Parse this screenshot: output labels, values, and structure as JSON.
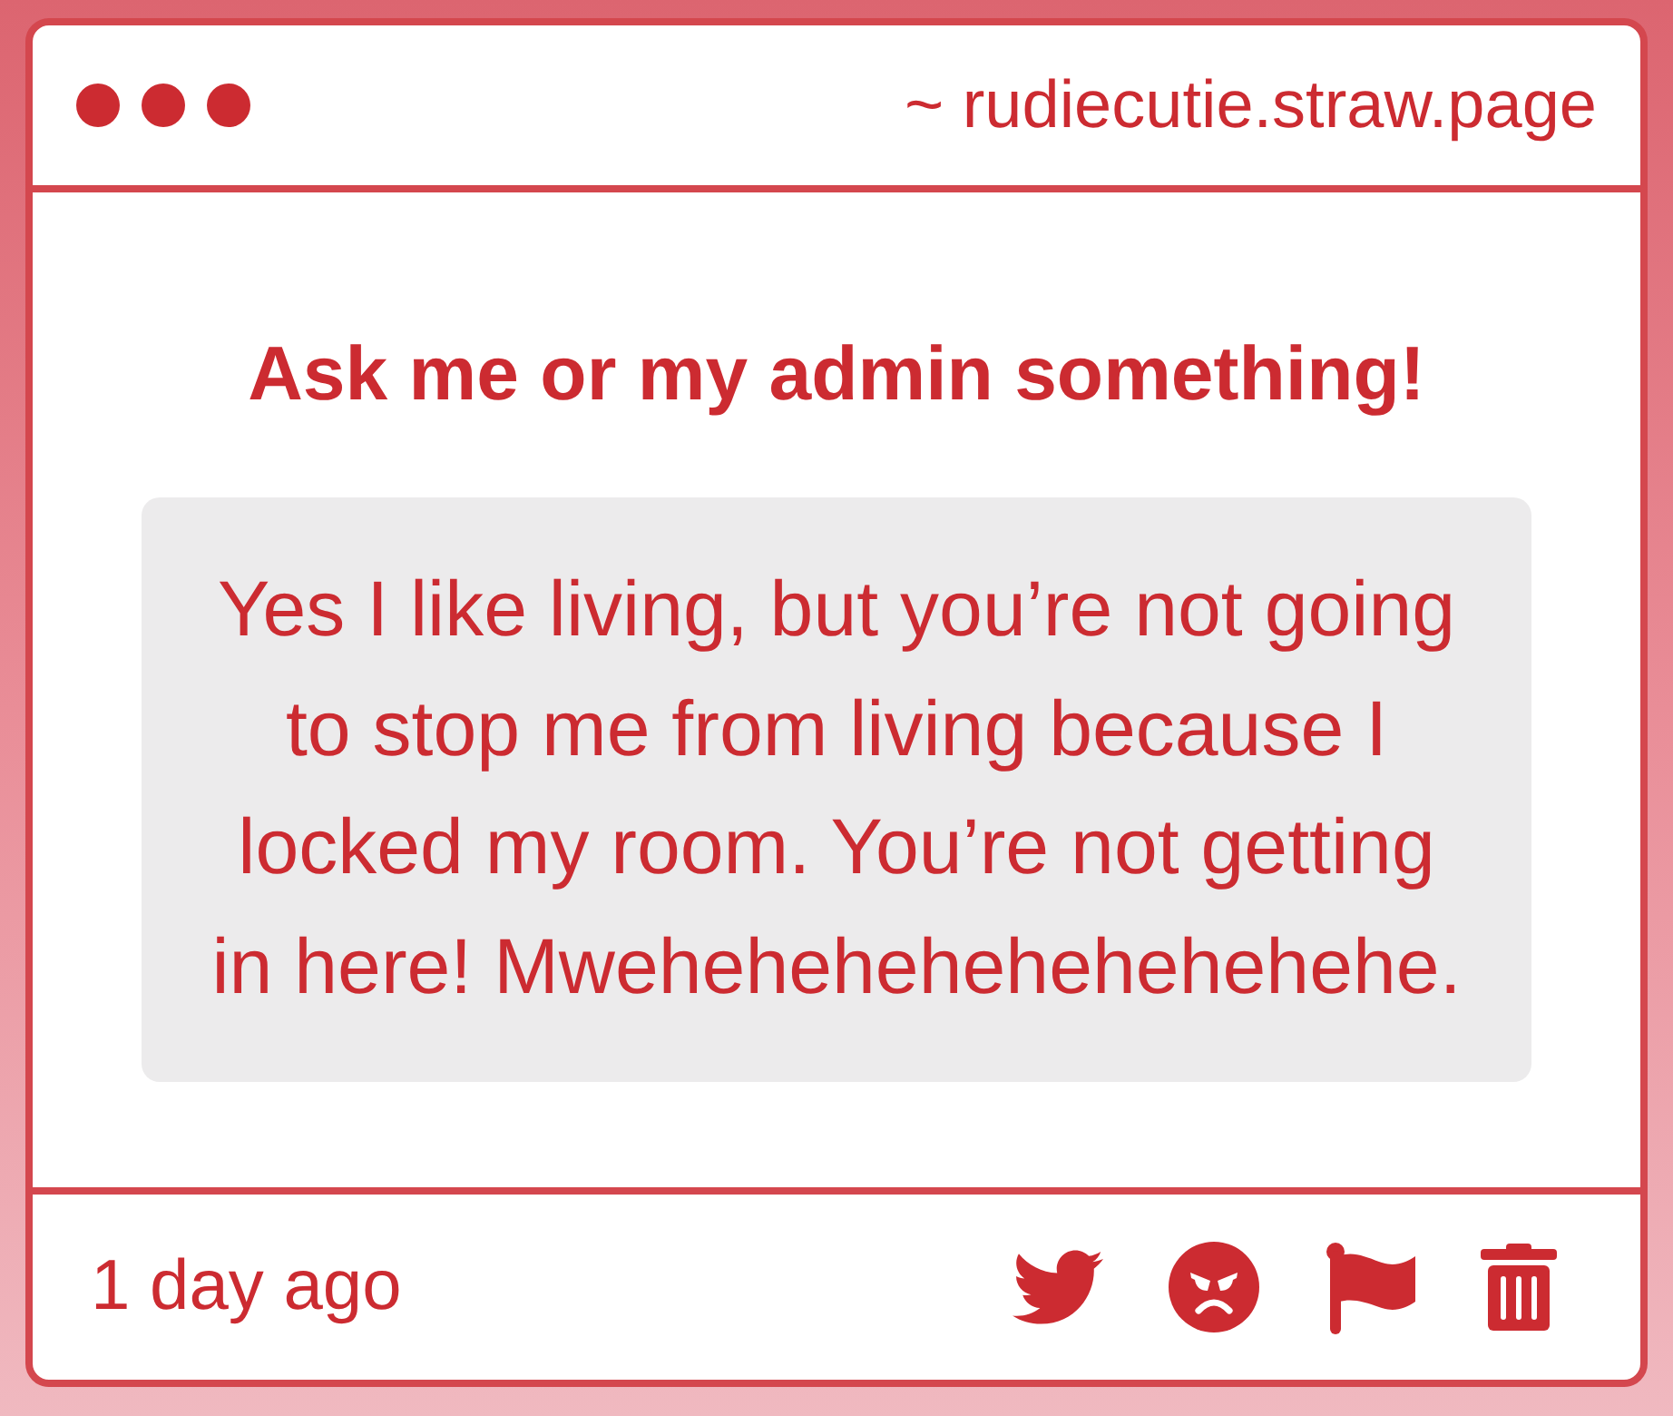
{
  "window": {
    "address": "~ rudiecutie.straw.page"
  },
  "question": {
    "heading": "Ask me or my admin something!",
    "answer": "Yes I like living, but you’re not going to stop me from living because I locked my room. You’re not getting in here! Mwehehehehehehehehehe."
  },
  "footer": {
    "timestamp": "1 day ago"
  }
}
